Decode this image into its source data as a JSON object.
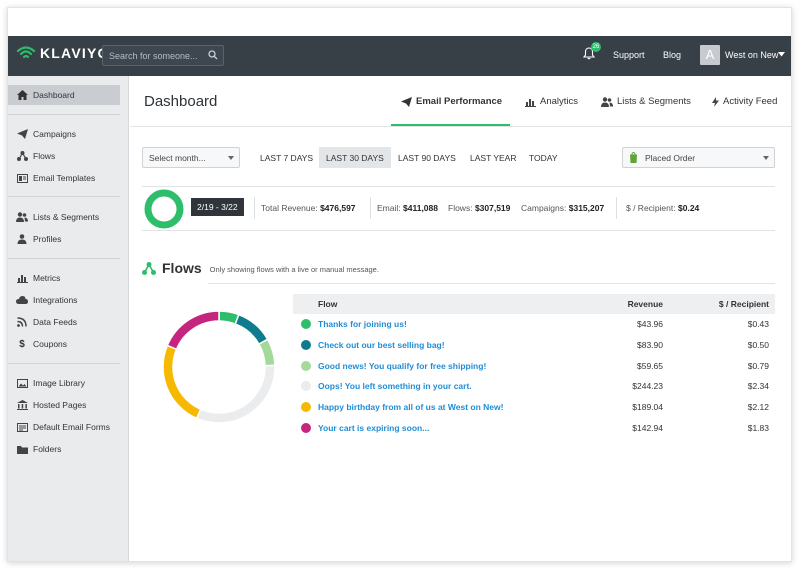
{
  "app": {
    "brand": "KLAVIYO"
  },
  "header": {
    "search_placeholder": "Search for someone...",
    "notification_count": "26",
    "links": [
      "Support",
      "Blog"
    ],
    "avatar_letter": "A",
    "account_name": "West on New"
  },
  "sidebar": {
    "items": [
      {
        "label": "Dashboard",
        "icon": "home-icon",
        "active": true
      },
      {
        "label": "Campaigns",
        "icon": "paper-plane-icon"
      },
      {
        "label": "Flows",
        "icon": "flows-icon"
      },
      {
        "label": "Email Templates",
        "icon": "template-icon"
      },
      {
        "label": "Lists & Segments",
        "icon": "users-icon"
      },
      {
        "label": "Profiles",
        "icon": "user-icon"
      },
      {
        "label": "Metrics",
        "icon": "bar-chart-icon"
      },
      {
        "label": "Integrations",
        "icon": "cloud-icon"
      },
      {
        "label": "Data Feeds",
        "icon": "rss-icon"
      },
      {
        "label": "Coupons",
        "icon": "dollar-icon"
      },
      {
        "label": "Image Library",
        "icon": "image-icon"
      },
      {
        "label": "Hosted Pages",
        "icon": "building-icon"
      },
      {
        "label": "Default Email Forms",
        "icon": "form-icon"
      },
      {
        "label": "Folders",
        "icon": "folder-icon"
      }
    ]
  },
  "page": {
    "title": "Dashboard",
    "tabs": [
      {
        "label": "Email Performance",
        "icon": "paper-plane-icon",
        "active": true
      },
      {
        "label": "Analytics",
        "icon": "bar-chart-icon"
      },
      {
        "label": "Lists & Segments",
        "icon": "users-icon"
      },
      {
        "label": "Activity Feed",
        "icon": "bolt-icon"
      }
    ]
  },
  "filters": {
    "month_select": "Select month...",
    "ranges": [
      "LAST 7 DAYS",
      "LAST 30 DAYS",
      "LAST 90 DAYS",
      "LAST YEAR",
      "TODAY"
    ],
    "active_range": "LAST 30 DAYS",
    "metric_select": "Placed Order"
  },
  "stats": {
    "date_range": "2/19 - 3/22",
    "total_revenue_label": "Total Revenue:",
    "total_revenue": "$476,597",
    "email_label": "Email:",
    "email": "$411,088",
    "flows_label": "Flows:",
    "flows": "$307,519",
    "campaigns_label": "Campaigns:",
    "campaigns": "$315,207",
    "per_recipient_label": "$ / Recipient:",
    "per_recipient": "$0.24"
  },
  "flows": {
    "title": "Flows",
    "subtitle": "Only showing flows with a live or manual message.",
    "columns": [
      "Flow",
      "Revenue",
      "$ / Recipient"
    ],
    "rows": [
      {
        "name": "Thanks for joining us!",
        "revenue": "$43.96",
        "per_recipient": "$0.43",
        "color": "#2ebd6b"
      },
      {
        "name": "Check out our best selling bag!",
        "revenue": "$83.90",
        "per_recipient": "$0.50",
        "color": "#0f7b8f"
      },
      {
        "name": "Good news! You qualify for free shipping!",
        "revenue": "$59.65",
        "per_recipient": "$0.79",
        "color": "#a5d99a"
      },
      {
        "name": "Oops! You left something in your cart.",
        "revenue": "$244.23",
        "per_recipient": "$2.34",
        "color": "#ebeced"
      },
      {
        "name": "Happy birthday from all of us at West on New!",
        "revenue": "$189.04",
        "per_recipient": "$2.12",
        "color": "#f7b900"
      },
      {
        "name": "Your cart is expiring soon...",
        "revenue": "$142.94",
        "per_recipient": "$1.83",
        "color": "#c5257f"
      }
    ]
  },
  "colors": {
    "accent": "#2ebd6b",
    "topbar": "#373f47",
    "link": "#1f8dd6"
  }
}
